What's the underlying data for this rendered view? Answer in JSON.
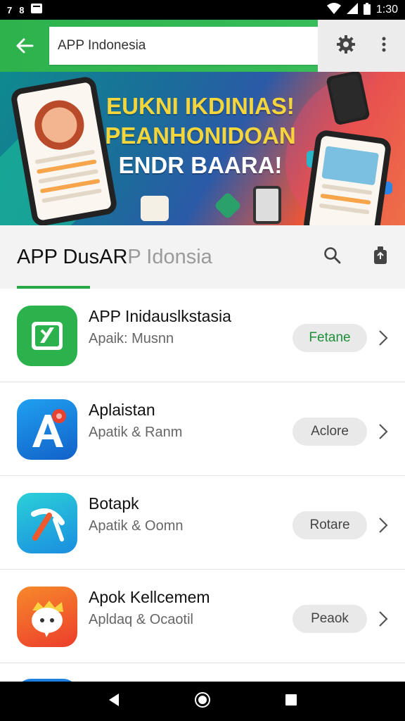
{
  "status_bar": {
    "time": "1:30",
    "left_glyphs": [
      "7",
      "8"
    ]
  },
  "app_bar": {
    "search_value": "APP Indonesia"
  },
  "banner": {
    "line1": "EUKNI IKDINIAS!",
    "line2": "PEANHONIDOAN",
    "line3": "ENDR BAARA!"
  },
  "header": {
    "title_dark": "APP  DusAR",
    "title_light": "P Idonsia"
  },
  "apps": [
    {
      "title": "APP Inidauslkstasia",
      "subtitle": "Apaik: Musnn",
      "button": "Fetane",
      "button_color": "#1e8f3a",
      "icon": "app-green-icon",
      "icon_color": "#2bb24c"
    },
    {
      "title": "Aplaistan",
      "subtitle": "Apatik & Ranm",
      "button": "Aclore",
      "icon": "app-a-icon",
      "icon_color": "#1d7fe0"
    },
    {
      "title": "Botapk",
      "subtitle": "Apatik & Oomn",
      "button": "Rotare",
      "icon": "app-pickaxe-icon",
      "icon_color": "#1fb6d6"
    },
    {
      "title": "Apok Kellcemem",
      "subtitle": "Apldaq & Ocaotil",
      "button": "Peaok",
      "icon": "app-mascot-icon",
      "icon_color": "#f0582e"
    }
  ],
  "colors": {
    "accent_green": "#2db24c",
    "nav_black": "#000000"
  }
}
